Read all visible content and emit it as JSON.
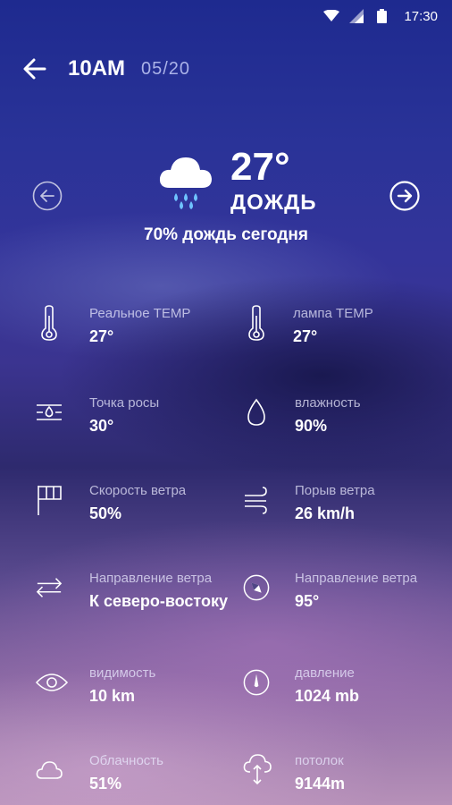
{
  "status_bar": {
    "time": "17:30"
  },
  "header": {
    "time": "10AM",
    "date": "05/20"
  },
  "current": {
    "temperature": "27°",
    "condition": "ДОЖДЬ",
    "summary": "70% дождь сегодня",
    "icon": "cloud-rain-icon"
  },
  "details": [
    {
      "label": "Реальное TEMP",
      "value": "27°",
      "icon": "thermometer-icon"
    },
    {
      "label": "лампа TEMP",
      "value": "27°",
      "icon": "thermometer-icon"
    },
    {
      "label": "Точка росы",
      "value": "30°",
      "icon": "dew-point-icon"
    },
    {
      "label": "влажность",
      "value": "90%",
      "icon": "drop-icon"
    },
    {
      "label": "Скорость ветра",
      "value": "50%",
      "icon": "windsock-icon"
    },
    {
      "label": "Порыв ветра",
      "value": "26 km/h",
      "icon": "wind-gust-icon"
    },
    {
      "label": "Направление ветра",
      "value": "К северо-востоку",
      "icon": "wind-direction-arrows-icon"
    },
    {
      "label": "Направление ветра",
      "value": "95°",
      "icon": "compass-icon"
    },
    {
      "label": "видимость",
      "value": "10 km",
      "icon": "eye-icon"
    },
    {
      "label": "давление",
      "value": "1024 mb",
      "icon": "pressure-gauge-icon"
    },
    {
      "label": "Облачность",
      "value": "51%",
      "icon": "cloud-icon"
    },
    {
      "label": "потолок",
      "value": "9144m",
      "icon": "cloud-ceiling-icon"
    }
  ]
}
